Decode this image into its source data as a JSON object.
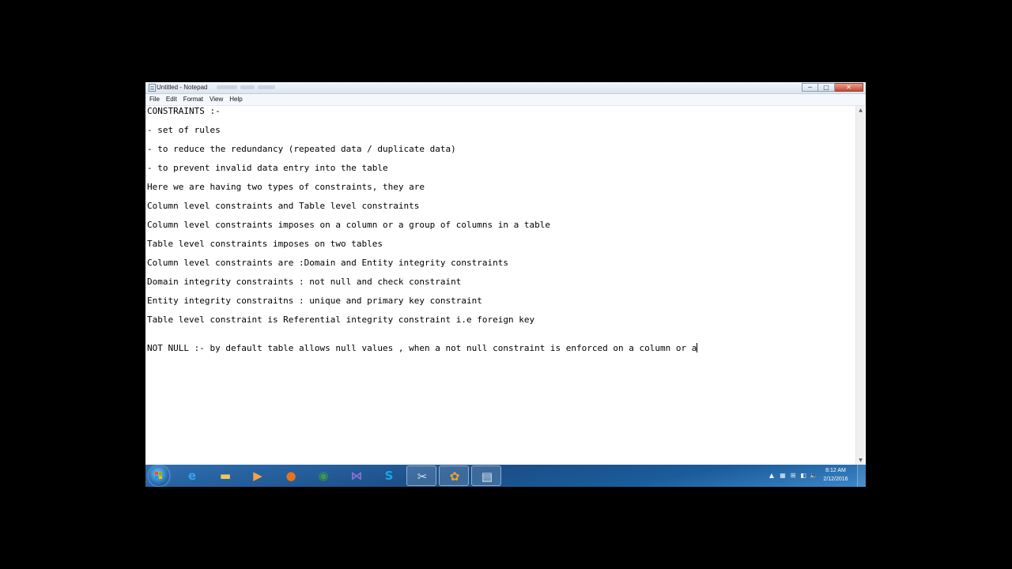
{
  "window": {
    "title": "Untitled - Notepad",
    "controls": {
      "minimize": "─",
      "maximize": "□",
      "close": "✕"
    }
  },
  "menu": [
    "File",
    "Edit",
    "Format",
    "View",
    "Help"
  ],
  "editor": {
    "lines": [
      "CONSTRAINTS :-",
      "- set of rules",
      "- to reduce the redundancy (repeated data / duplicate data)",
      "- to prevent invalid data entry into the table",
      "Here we are having two types of constraints, they are",
      "Column level constraints and Table level constraints",
      "Column level constraints imposes on a column or a group of columns in a table",
      "Table level constraints imposes on two tables",
      "Column level constraints are :Domain and Entity integrity constraints",
      "Domain integrity constraints : not null and check constraint",
      "Entity integrity constraitns : unique and primary key constraint",
      "Table level constraint is Referential integrity constraint i.e foreign key",
      "NOT NULL :- by default table allows null values , when a not null constraint is enforced on a column or a"
    ]
  },
  "scrollbar": {
    "up": "▲",
    "down": "▼"
  },
  "taskbar": {
    "apps": [
      {
        "name": "internet-explorer-icon",
        "glyph": "e",
        "color": "#3aa0e8"
      },
      {
        "name": "file-explorer-icon",
        "glyph": "▬",
        "color": "#f1c75a"
      },
      {
        "name": "media-player-icon",
        "glyph": "▶",
        "color": "#f3a348"
      },
      {
        "name": "firefox-icon",
        "glyph": "●",
        "color": "#e8731c"
      },
      {
        "name": "chrome-icon",
        "glyph": "◉",
        "color": "#3e9a48"
      },
      {
        "name": "visual-studio-icon",
        "glyph": "⋈",
        "color": "#8b6fd6"
      },
      {
        "name": "skype-icon",
        "glyph": "S",
        "color": "#1ba3e8"
      },
      {
        "name": "tools-icon",
        "glyph": "✂",
        "color": "#cfe4f7"
      },
      {
        "name": "settings-app-icon",
        "glyph": "✿",
        "color": "#f2a51f"
      },
      {
        "name": "notepad-taskbar-icon",
        "glyph": "▤",
        "color": "#dce9f6"
      }
    ],
    "tray": {
      "up_arrow": "▲",
      "icons": [
        "▦",
        "⊞",
        "◧",
        "🔈"
      ]
    },
    "time": "8:12 AM",
    "date": "2/12/2016"
  },
  "colors": {
    "taskbar": "#1b4f88",
    "start": "#2a73b8",
    "background": "#000000"
  }
}
